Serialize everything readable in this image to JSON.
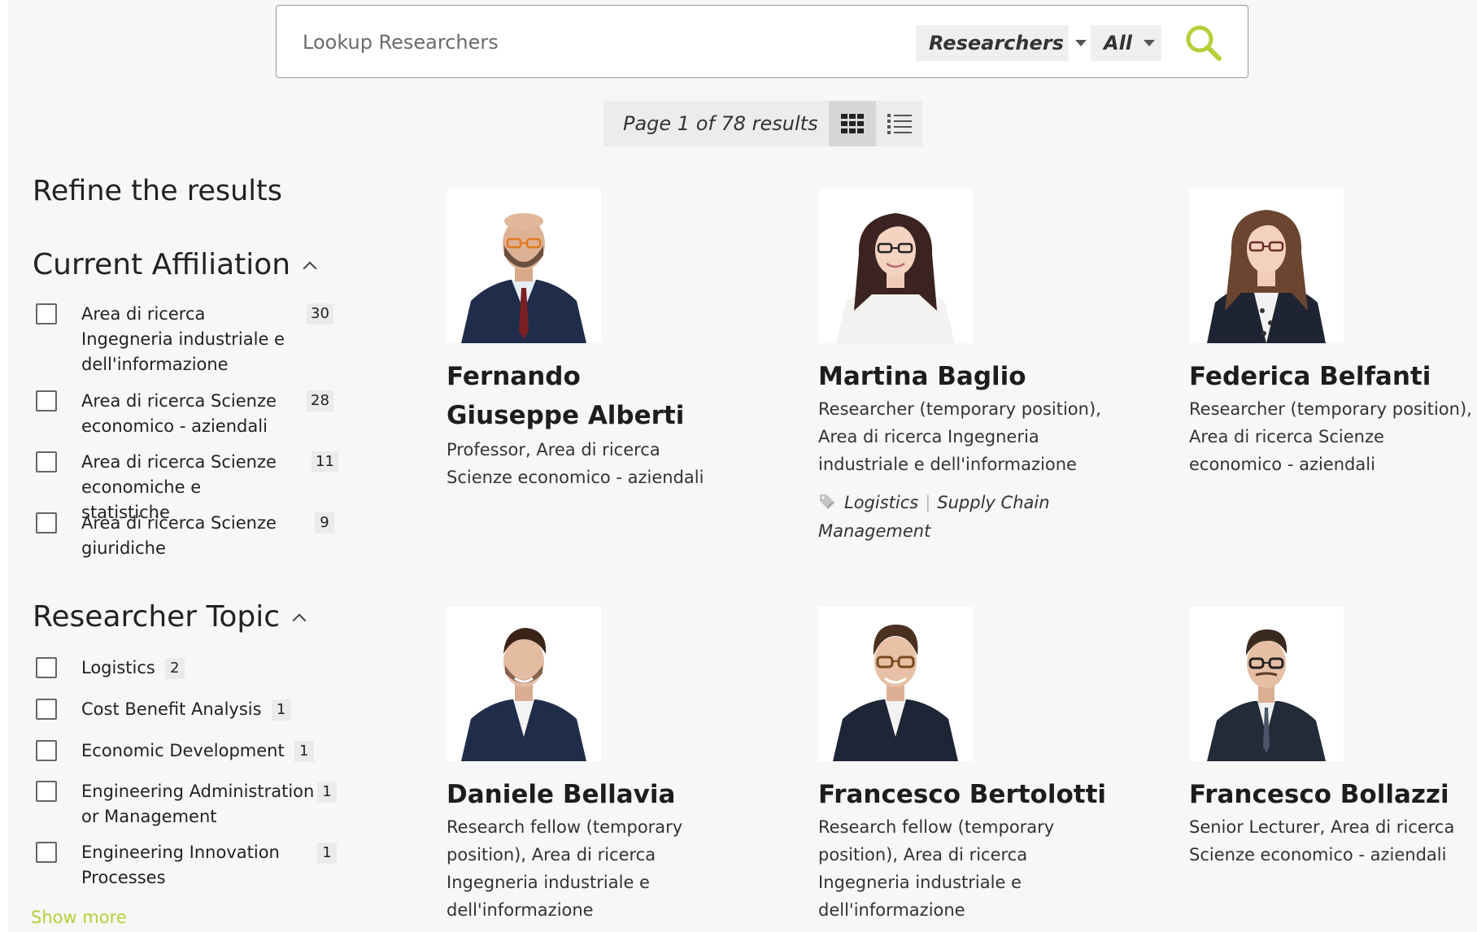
{
  "search": {
    "placeholder": "Lookup Researchers",
    "type_dropdown": "Researchers",
    "scope_dropdown": "All",
    "accent_color": "#b6cf3a"
  },
  "pager": {
    "text": "Page 1 of 78 results",
    "grid_icon": "grid-view-icon",
    "list_icon": "list-view-icon"
  },
  "sidebar": {
    "title": "Refine the results",
    "affiliation": {
      "heading": "Current Affiliation",
      "items": [
        {
          "label": "Area di ricerca Ingegneria industriale e dell'informazione",
          "count": "30"
        },
        {
          "label": "Area di ricerca Scienze economico - aziendali",
          "count": "28"
        },
        {
          "label": "Area di ricerca Scienze economiche e statistiche",
          "count": "11"
        },
        {
          "label": "Area di ricerca Scienze giuridiche",
          "count": "9"
        }
      ]
    },
    "topic": {
      "heading": "Researcher Topic",
      "items": [
        {
          "label": "Logistics",
          "count": "2"
        },
        {
          "label": "Cost Benefit Analysis",
          "count": "1"
        },
        {
          "label": "Economic Development",
          "count": "1"
        },
        {
          "label": "Engineering Administration or Management",
          "count": "1"
        },
        {
          "label": "Engineering Innovation Processes",
          "count": "1"
        }
      ]
    },
    "show_more": "Show more"
  },
  "researchers": [
    {
      "name": "Fernando Giuseppe Alberti",
      "role": "Professor, Area di ricerca Scienze economico - aziendali"
    },
    {
      "name": "Martina Baglio",
      "role": "Researcher (temporary position), Area di ricerca Ingegneria industriale e dell'informazione",
      "tags": [
        "Logistics",
        "Supply Chain Management"
      ]
    },
    {
      "name": "Federica Belfanti",
      "role": "Researcher (temporary position), Area di ricerca Scienze economico - aziendali"
    },
    {
      "name": "Daniele Bellavia",
      "role": "Research fellow (temporary position), Area di ricerca Ingegneria industriale e dell'informazione"
    },
    {
      "name": "Francesco Bertolotti",
      "role": "Research fellow (temporary position), Area di ricerca Ingegneria industriale e dell'informazione"
    },
    {
      "name": "Francesco Bollazzi",
      "role": "Senior Lecturer, Area di ricerca Scienze economico - aziendali"
    }
  ]
}
